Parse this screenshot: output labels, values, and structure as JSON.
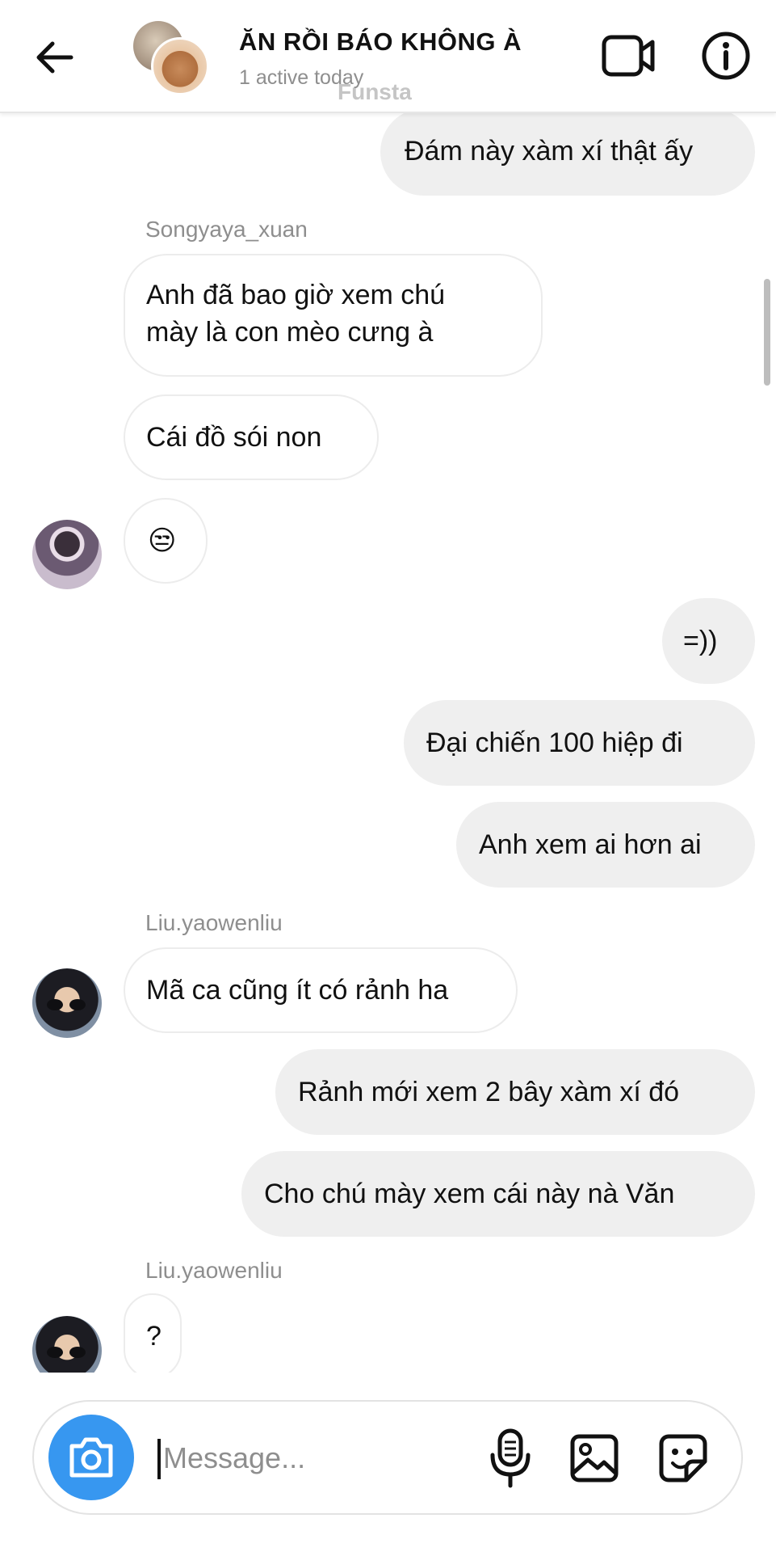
{
  "header": {
    "back_icon": "arrow-left-icon",
    "title": "ĂN RỒI BÁO KHÔNG À",
    "status": "1 active today",
    "watermark": "Funsta",
    "video_icon": "video-camera-icon",
    "info_icon": "info-icon"
  },
  "messages": [
    {
      "dir": "out",
      "text": "Đám này xàm xí thật ấy"
    },
    {
      "sender": "Songyaya_xuan"
    },
    {
      "dir": "in",
      "line1": "Anh đã bao giờ xem chú",
      "line2": "mày là con mèo cưng à"
    },
    {
      "dir": "in",
      "text": "Cái đồ sói non"
    },
    {
      "dir": "in",
      "text": "😒"
    },
    {
      "dir": "out",
      "text": "=))"
    },
    {
      "dir": "out",
      "text": "Đại chiến 100 hiệp đi"
    },
    {
      "dir": "out",
      "text": "Anh xem ai hơn ai"
    },
    {
      "sender": "Liu.yaowenliu"
    },
    {
      "dir": "in",
      "text": "Mã ca cũng ít có rảnh ha"
    },
    {
      "dir": "out",
      "text": "Rảnh mới xem 2 bây xàm xí đó"
    },
    {
      "dir": "out",
      "text": "Cho chú mày xem cái này nà Văn"
    },
    {
      "sender": "Liu.yaowenliu"
    },
    {
      "dir": "in",
      "text": "?"
    }
  ],
  "composer": {
    "placeholder": "Message...",
    "camera_icon": "camera-icon",
    "mic_icon": "microphone-icon",
    "gallery_icon": "image-gallery-icon",
    "sticker_icon": "sticker-icon"
  },
  "colors": {
    "accent": "#3797f0",
    "outgoing_bubble": "#efefef",
    "secondary_text": "#8e8e8e"
  }
}
